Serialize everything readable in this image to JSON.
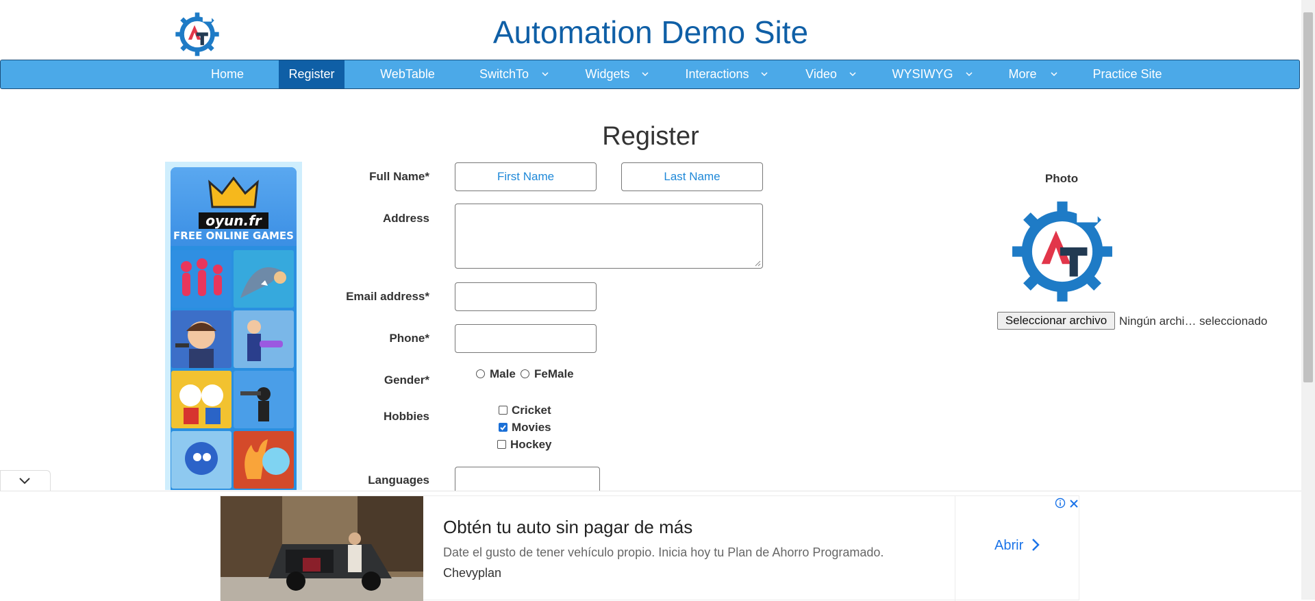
{
  "header": {
    "title": "Automation Demo Site"
  },
  "nav": {
    "items": [
      {
        "label": "Home"
      },
      {
        "label": "Register"
      },
      {
        "label": "WebTable"
      },
      {
        "label": "SwitchTo"
      },
      {
        "label": "Widgets"
      },
      {
        "label": "Interactions"
      },
      {
        "label": "Video"
      },
      {
        "label": "WYSIWYG"
      },
      {
        "label": "More"
      },
      {
        "label": "Practice Site"
      }
    ],
    "active": "Register"
  },
  "page": {
    "heading": "Register"
  },
  "side_ad": {
    "brand": "oyun.fr",
    "tagline": "FREE ONLINE GAMES"
  },
  "form": {
    "full_name_label": "Full Name*",
    "first_name_placeholder": "First Name",
    "last_name_placeholder": "Last Name",
    "address_label": "Address",
    "email_label": "Email address*",
    "phone_label": "Phone*",
    "gender_label": "Gender*",
    "gender_options": [
      "Male",
      "FeMale"
    ],
    "hobbies_label": "Hobbies",
    "hobbies": [
      {
        "label": "Cricket",
        "checked": false
      },
      {
        "label": "Movies",
        "checked": true
      },
      {
        "label": "Hockey",
        "checked": false
      }
    ],
    "languages_label": "Languages"
  },
  "photo": {
    "label": "Photo",
    "button_label": "Seleccionar archivo",
    "status": "Ningún archi… seleccionado"
  },
  "bottom_ad": {
    "headline": "Obtén tu auto sin pagar de más",
    "description": "Date el gusto de tener vehículo propio. Inicia hoy tu Plan de Ahorro Programado.",
    "advertiser": "Chevyplan",
    "cta": "Abrir",
    "info_icon": "info-icon",
    "close_icon": "close-icon"
  },
  "colors": {
    "navbar": "#4ba9e8",
    "nav_active": "#0f5fa6",
    "title": "#0f5fa6",
    "placeholder": "#1e88d8",
    "ad_cta": "#1a73e8"
  }
}
